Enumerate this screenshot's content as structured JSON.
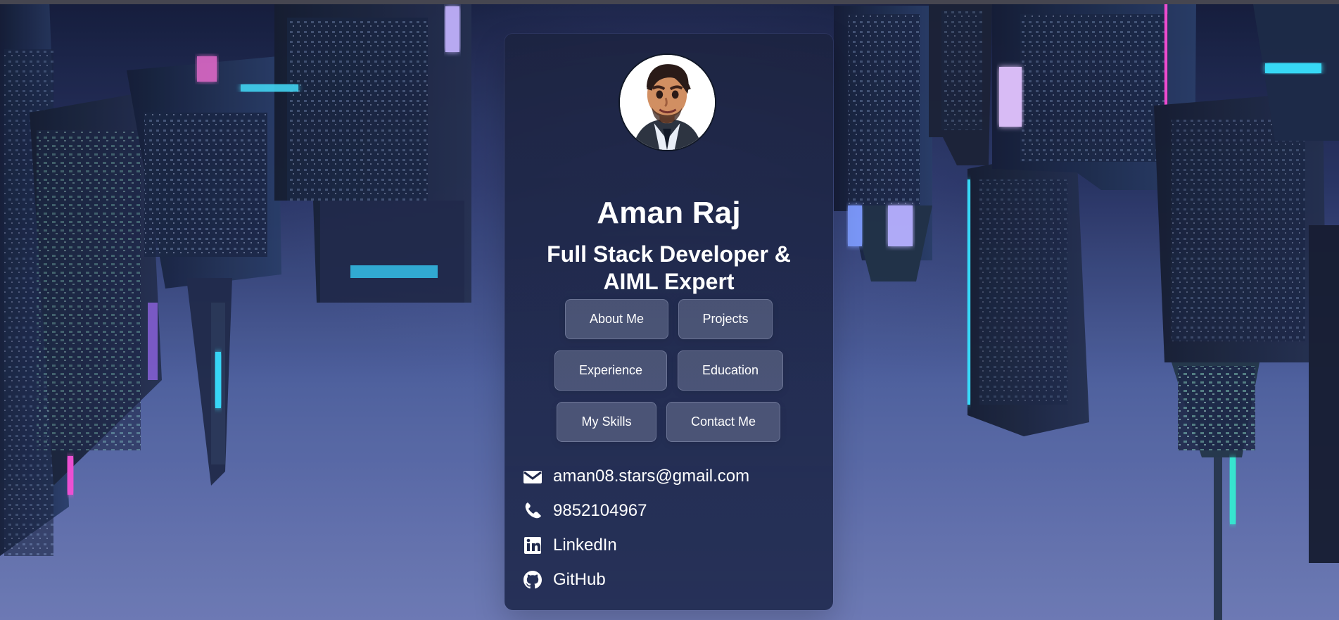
{
  "colors": {
    "background_deep": "#101733",
    "background_mid": "#4d5f9b",
    "card": "#1e284b",
    "button": "#707897",
    "text": "#ffffff",
    "neon_pink": "#ff4bd6",
    "neon_cyan": "#32e3ff"
  },
  "profile": {
    "name": "Aman Raj",
    "role": "Full Stack Developer & AIML Expert",
    "avatar_icon": "avatar-person-icon"
  },
  "navigation": {
    "buttons": [
      {
        "label": "About Me"
      },
      {
        "label": "Projects"
      },
      {
        "label": "Experience"
      },
      {
        "label": "Education"
      },
      {
        "label": "My Skills"
      },
      {
        "label": "Contact Me"
      }
    ]
  },
  "contacts": [
    {
      "icon": "mail-icon",
      "text": "aman08.stars@gmail.com"
    },
    {
      "icon": "phone-icon",
      "text": "9852104967"
    },
    {
      "icon": "linkedin-icon",
      "text": "LinkedIn"
    },
    {
      "icon": "github-icon",
      "text": "GitHub"
    }
  ]
}
